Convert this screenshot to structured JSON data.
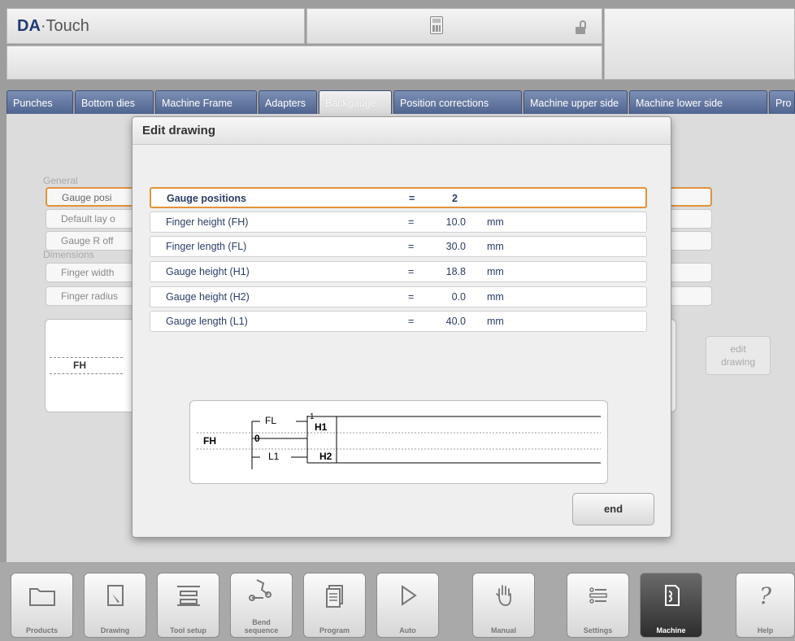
{
  "header": {
    "logo_prefix": "DA",
    "logo_suffix": "·Touch"
  },
  "tabs": [
    {
      "label": "Punches"
    },
    {
      "label": "Bottom dies"
    },
    {
      "label": "Machine Frame"
    },
    {
      "label": "Adapters"
    },
    {
      "label": "Backgauge"
    },
    {
      "label": "Position corrections"
    },
    {
      "label": "Machine upper side"
    },
    {
      "label": "Machine lower side"
    },
    {
      "label": "Pro"
    }
  ],
  "background_form": {
    "general_label": "General",
    "fields": [
      "Gauge posi",
      "Default lay o",
      "Gauge R off",
      "Finger width",
      "Finger radius"
    ],
    "dimensions_label": "Dimensions",
    "preview_label": "FH",
    "edit_drawing_label_line1": "edit",
    "edit_drawing_label_line2": "drawing"
  },
  "dialog": {
    "title": "Edit drawing",
    "rows": [
      {
        "label": "Gauge positions",
        "eq": "=",
        "value": "2",
        "unit": ""
      },
      {
        "label": "Finger height (FH)",
        "eq": "=",
        "value": "10.0",
        "unit": "mm"
      },
      {
        "label": "Finger length (FL)",
        "eq": "=",
        "value": "30.0",
        "unit": "mm"
      },
      {
        "label": "Gauge height (H1)",
        "eq": "=",
        "value": "18.8",
        "unit": "mm"
      },
      {
        "label": "Gauge height (H2)",
        "eq": "=",
        "value": "0.0",
        "unit": "mm"
      },
      {
        "label": "Gauge length (L1)",
        "eq": "=",
        "value": "40.0",
        "unit": "mm"
      }
    ],
    "drawing": {
      "fh": "FH",
      "fl": "FL",
      "l1": "L1",
      "h1": "H1",
      "h2": "H2",
      "zero": "0",
      "one": "1"
    },
    "end_label": "end"
  },
  "nav": [
    {
      "label": "Products",
      "icon": "folder-icon"
    },
    {
      "label": "Drawing",
      "icon": "drawing-icon"
    },
    {
      "label": "Tool setup",
      "icon": "tool-setup-icon"
    },
    {
      "label": "Bend\nsequence",
      "icon": "bend-sequence-icon"
    },
    {
      "label": "Program",
      "icon": "program-icon"
    },
    {
      "label": "Auto",
      "icon": "play-icon"
    },
    {
      "label": "Manual",
      "icon": "hand-icon"
    },
    {
      "label": "Settings",
      "icon": "settings-icon"
    },
    {
      "label": "Machine",
      "icon": "machine-icon"
    },
    {
      "label": "Help",
      "icon": "help-icon"
    }
  ]
}
